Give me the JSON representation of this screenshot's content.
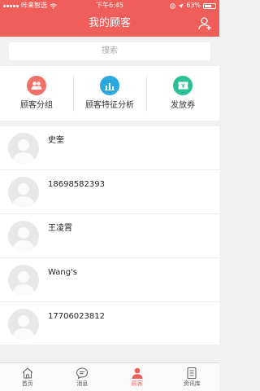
{
  "status_bar": {
    "carrier": "咔来智选",
    "time": "下午6:45",
    "battery": "63%"
  },
  "header": {
    "title": "我的顾客"
  },
  "search": {
    "placeholder": "搜索"
  },
  "features": [
    {
      "label": "顾客分组",
      "color": "#f0706a",
      "icon": "group-icon"
    },
    {
      "label": "顾客特征分析",
      "color": "#2aa9e0",
      "icon": "chart-icon"
    },
    {
      "label": "发放券",
      "color": "#2dbf97",
      "icon": "coupon-icon"
    }
  ],
  "customers": [
    {
      "name": "史奎"
    },
    {
      "name": "18698582393"
    },
    {
      "name": "王凌霄"
    },
    {
      "name": "Wang's"
    },
    {
      "name": "17706023812"
    }
  ],
  "tabbar": [
    {
      "label": "首页",
      "icon": "home-icon"
    },
    {
      "label": "消息",
      "icon": "message-icon"
    },
    {
      "label": "顾客",
      "icon": "customer-icon",
      "active": true
    },
    {
      "label": "资讯库",
      "icon": "library-icon"
    }
  ],
  "colors": {
    "brand": "#f05e5a"
  }
}
